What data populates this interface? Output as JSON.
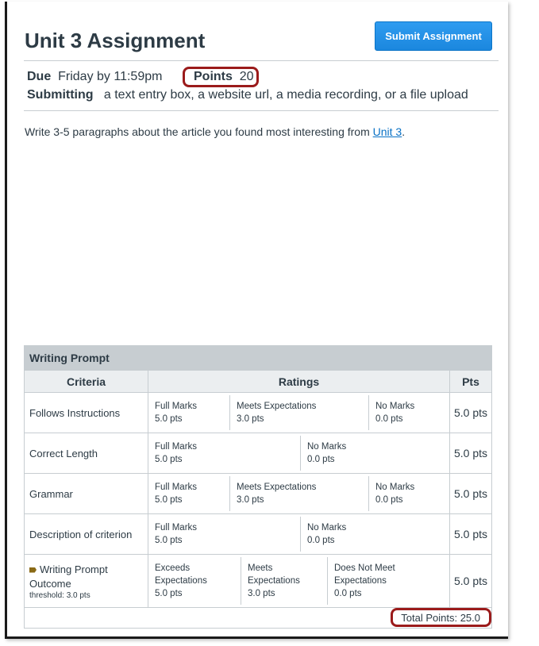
{
  "assignment": {
    "title": "Unit 3 Assignment",
    "submit_label": "Submit Assignment",
    "due_label": "Due",
    "due_value": "Friday by 11:59pm",
    "points_label": "Points",
    "points_value": "20",
    "submitting_label": "Submitting",
    "submitting_value": "a text entry box, a website url, a media recording, or a file upload",
    "description_prefix": "Write 3-5 paragraphs about the article you found most interesting from ",
    "description_link": "Unit 3",
    "description_suffix": "."
  },
  "rubric": {
    "title": "Writing Prompt",
    "headers": {
      "criteria": "Criteria",
      "ratings": "Ratings",
      "pts": "Pts"
    },
    "rows": [
      {
        "criterion": "Follows Instructions",
        "ratings": [
          {
            "name": "Full Marks",
            "points": "5.0 pts"
          },
          {
            "name": "Meets Expectations",
            "points": "3.0 pts"
          },
          {
            "name": "No Marks",
            "points": "0.0 pts"
          }
        ],
        "pts": "5.0 pts"
      },
      {
        "criterion": "Correct Length",
        "ratings": [
          {
            "name": "Full Marks",
            "points": "5.0 pts"
          },
          {
            "name": "No Marks",
            "points": "0.0 pts"
          }
        ],
        "pts": "5.0 pts"
      },
      {
        "criterion": "Grammar",
        "ratings": [
          {
            "name": "Full Marks",
            "points": "5.0 pts"
          },
          {
            "name": "Meets Expectations",
            "points": "3.0 pts"
          },
          {
            "name": "No Marks",
            "points": "0.0 pts"
          }
        ],
        "pts": "5.0 pts"
      },
      {
        "criterion": "Description of criterion",
        "ratings": [
          {
            "name": "Full Marks",
            "points": "5.0 pts"
          },
          {
            "name": "No Marks",
            "points": "0.0 pts"
          }
        ],
        "pts": "5.0 pts"
      },
      {
        "criterion": "Writing Prompt Outcome",
        "threshold": "threshold: 3.0 pts",
        "ratings": [
          {
            "name": "Exceeds Expectations",
            "points": "5.0 pts"
          },
          {
            "name": "Meets Expectations",
            "points": "3.0 pts"
          },
          {
            "name": "Does Not Meet Expectations",
            "points": "0.0 pts"
          }
        ],
        "pts": "5.0 pts"
      }
    ],
    "total": "Total Points: 25.0"
  },
  "colors": {
    "accent": "#008ee2",
    "highlight": "#9b1b1b",
    "link": "#0770c5"
  }
}
